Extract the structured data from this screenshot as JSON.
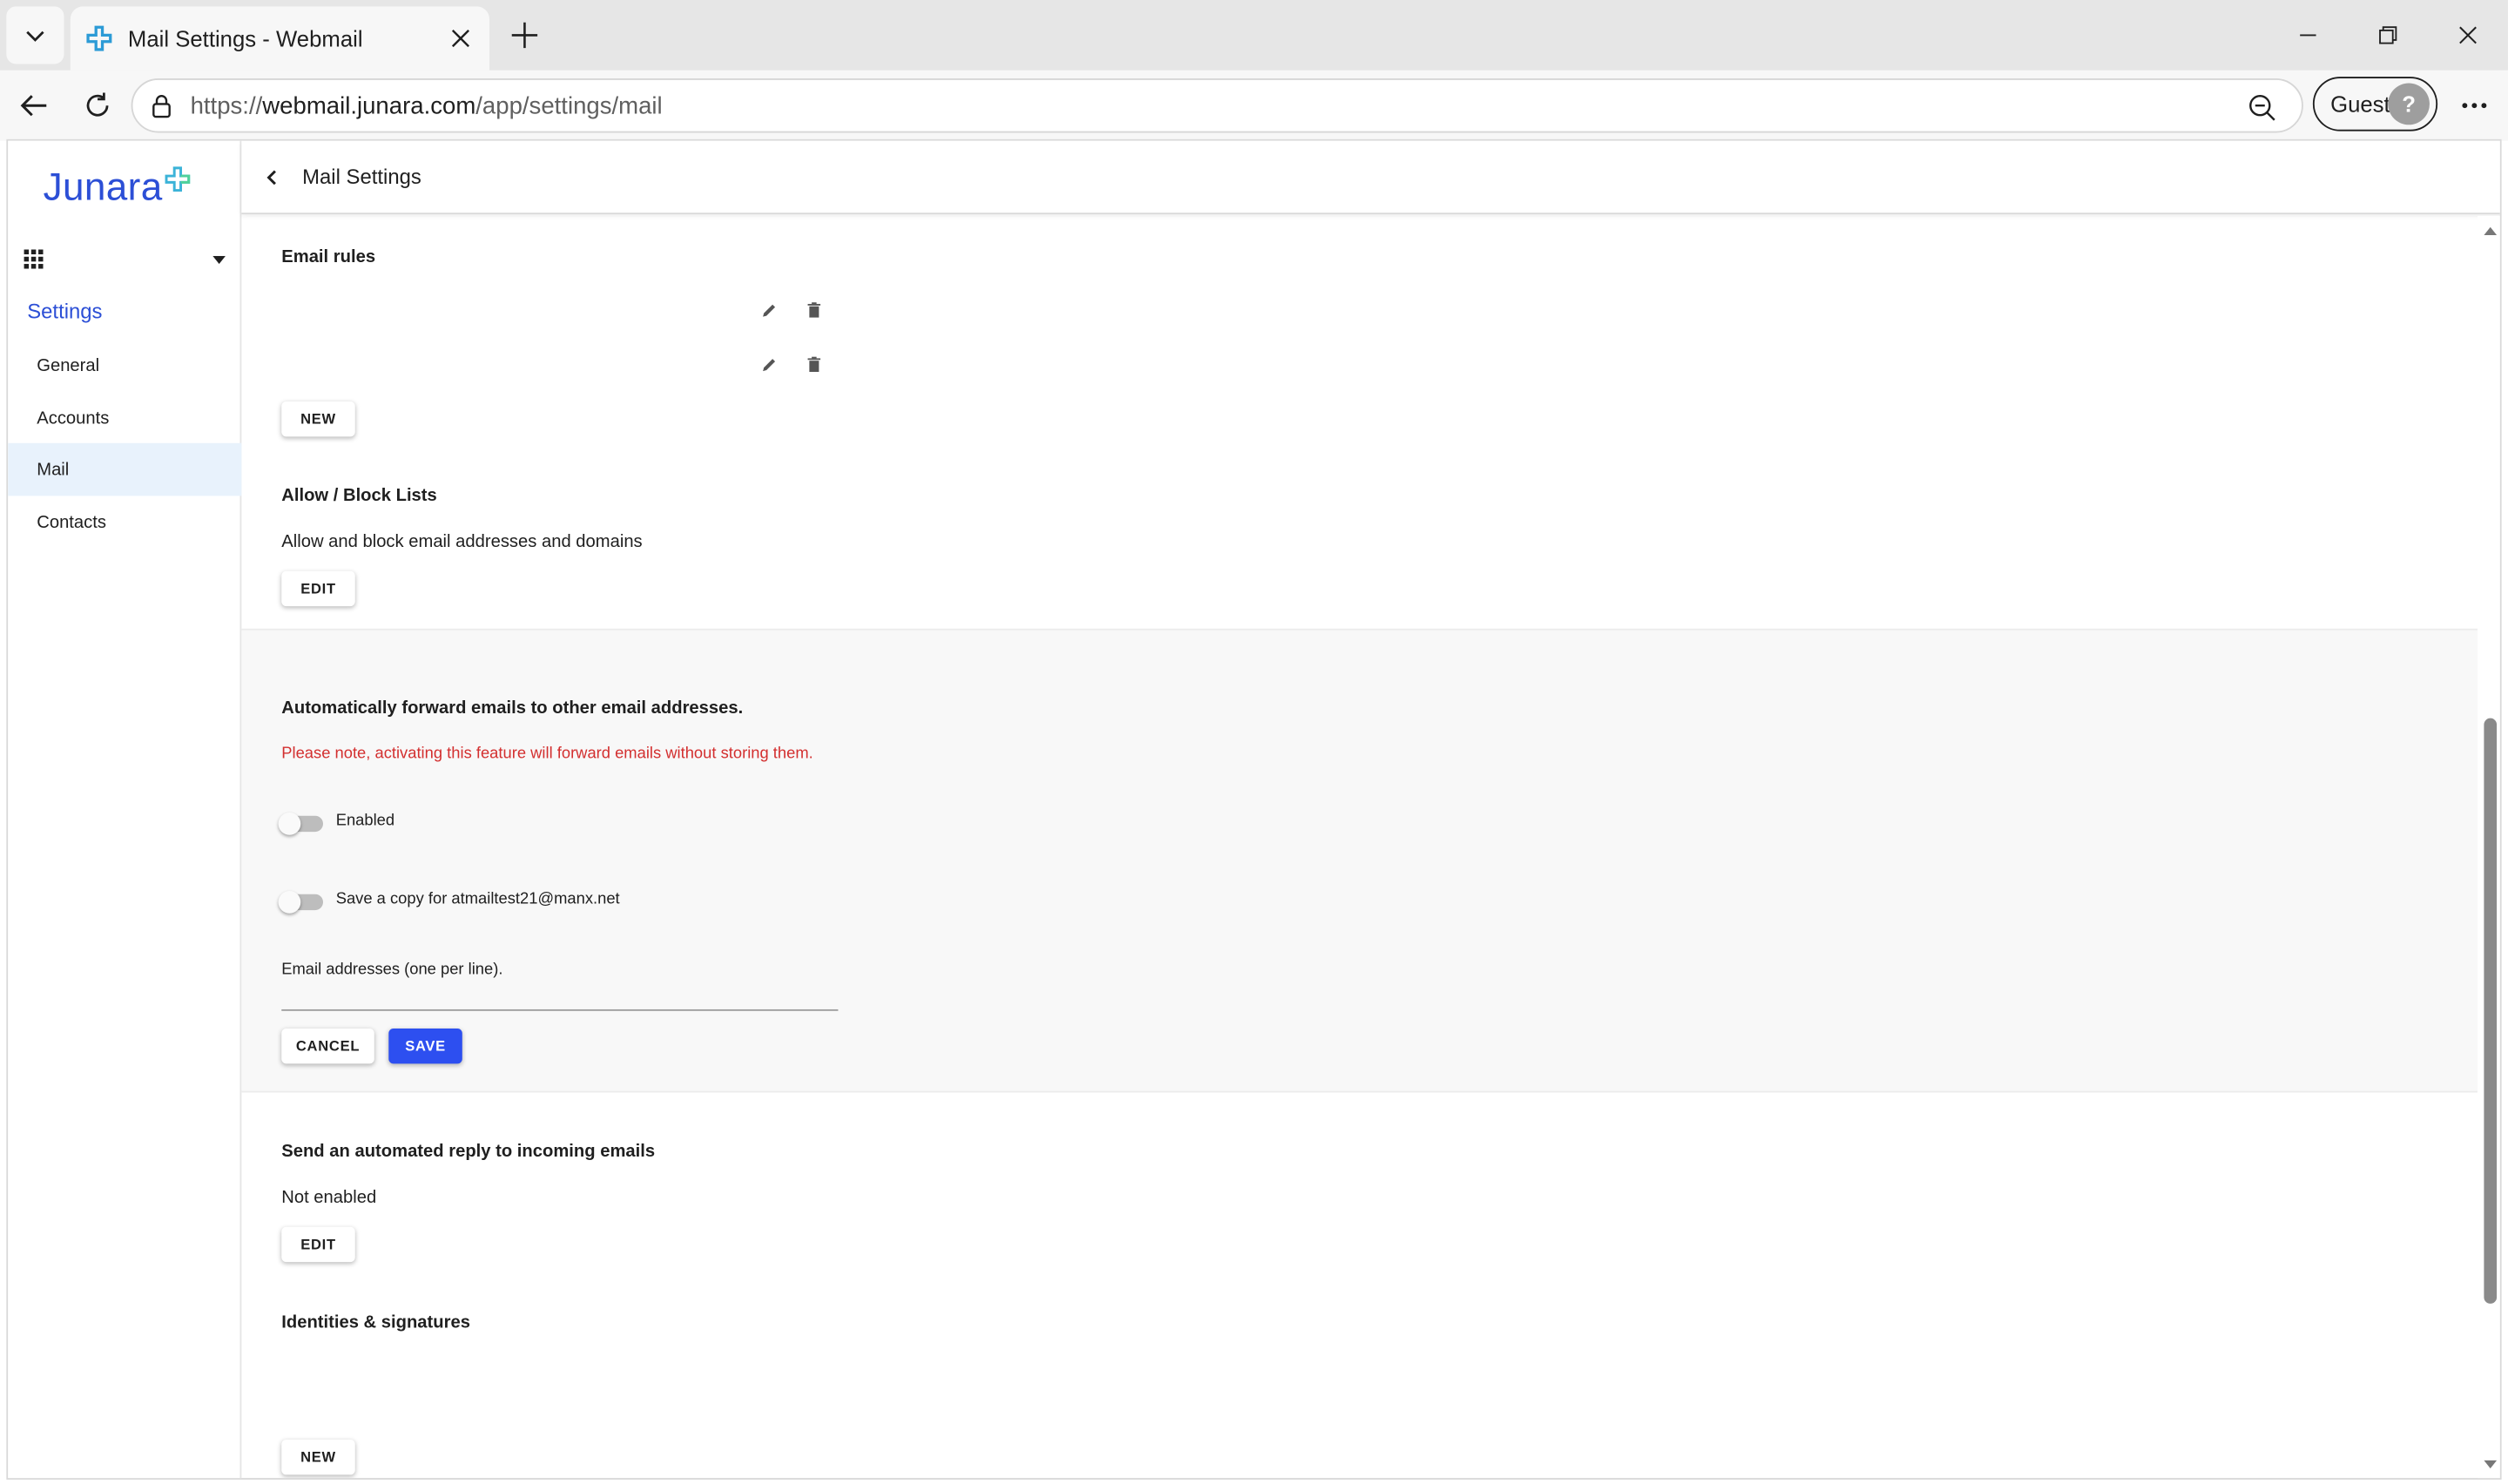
{
  "browser": {
    "tab_title": "Mail Settings - Webmail",
    "url_scheme": "https://",
    "url_host": "webmail.junara.com",
    "url_path": "/app/settings/mail",
    "profile_label": "Guest"
  },
  "sidebar": {
    "logo_text": "Junara",
    "section_title": "Settings",
    "items": [
      {
        "label": "General"
      },
      {
        "label": "Accounts"
      },
      {
        "label": "Mail"
      },
      {
        "label": "Contacts"
      }
    ]
  },
  "header": {
    "title": "Mail Settings"
  },
  "email_rules": {
    "title": "Email rules",
    "new_label": "NEW"
  },
  "allow_block": {
    "title": "Allow / Block Lists",
    "description": "Allow and block email addresses and domains",
    "edit_label": "EDIT"
  },
  "forwarding": {
    "title": "Automatically forward emails to other email addresses.",
    "warning": "Please note, activating this feature will forward emails without storing them.",
    "enabled_label": "Enabled",
    "save_copy_label": "Save a copy for atmailtest21@manx.net",
    "addresses_label": "Email addresses (one per line).",
    "cancel_label": "CANCEL",
    "save_label": "SAVE"
  },
  "auto_reply": {
    "title": "Send an automated reply to incoming emails",
    "status": "Not enabled",
    "edit_label": "EDIT"
  },
  "identities": {
    "title": "Identities & signatures",
    "new_label": "NEW"
  },
  "colors": {
    "accent": "#2c4fd6",
    "primary_button": "#2d4ff0",
    "warning": "#d32f2f",
    "active_nav": "#e8f2fc"
  }
}
